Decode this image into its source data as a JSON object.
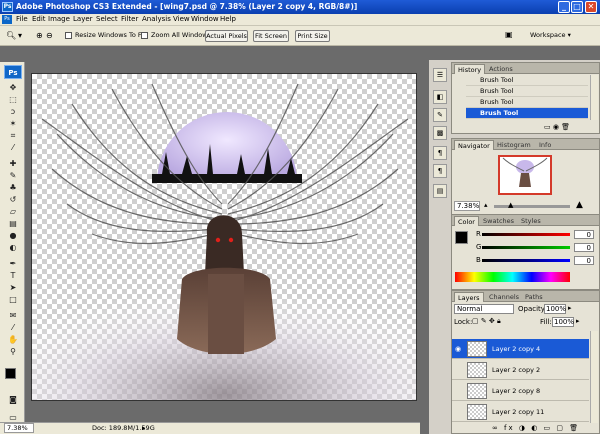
{
  "window": {
    "title": "Adobe Photoshop CS3 Extended - [wing7.psd @ 7.38% (Layer 2 copy 4, RGB/8#)]",
    "app_badge": "Ps",
    "min_glyph": "_",
    "max_glyph": "□",
    "close_glyph": "✕"
  },
  "menu": [
    "File",
    "Edit",
    "Image",
    "Layer",
    "Select",
    "Filter",
    "Analysis",
    "View",
    "Window",
    "Help"
  ],
  "options": {
    "resize_windows_label": "Resize Windows To Fit",
    "zoom_all_label": "Zoom All Windows",
    "actual_pixels": "Actual Pixels",
    "fit_screen": "Fit Screen",
    "print_size": "Print Size",
    "workspace": "Workspace ▾"
  },
  "status": {
    "zoom": "7.38%",
    "doc": "Doc: 189.8M/1.59G"
  },
  "history": {
    "tabs": [
      "History",
      "Actions"
    ],
    "items": [
      "Brush Tool",
      "Brush Tool",
      "Brush Tool",
      "Brush Tool"
    ],
    "selected_index": 3
  },
  "navigator": {
    "tabs": [
      "Navigator",
      "Histogram",
      "Info"
    ],
    "zoom": "7.38%"
  },
  "color": {
    "tabs": [
      "Color",
      "Swatches",
      "Styles"
    ],
    "r_label": "R",
    "g_label": "G",
    "b_label": "B",
    "r": 0,
    "g": 0,
    "b": 0
  },
  "layers": {
    "tabs": [
      "Layers",
      "Channels",
      "Paths"
    ],
    "blend_mode": "Normal",
    "opacity_label": "Opacity:",
    "opacity": "100%",
    "lock_label": "Lock:",
    "fill_label": "Fill:",
    "fill": "100%",
    "items": [
      "Layer 2 copy 4",
      "Layer 2 copy 2",
      "Layer 2 copy 8",
      "Layer 2 copy 11"
    ],
    "selected_index": 0
  },
  "colors": {
    "accent": "#1a5ad6",
    "title_bar": "#0a3fb0",
    "chrome": "#ece9d8"
  }
}
